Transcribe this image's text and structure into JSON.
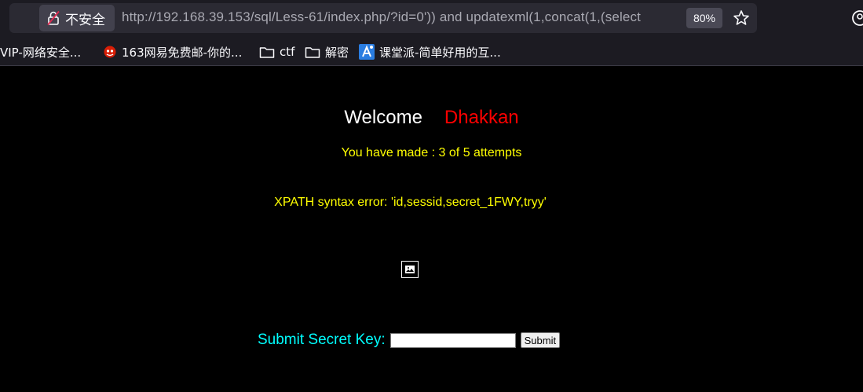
{
  "browser": {
    "security_label": "不安全",
    "url_host": "http://192.168.39.153",
    "url_rest": "/sql/Less-61/index.php/?id=0')) and updatexml(1,concat(1,(select",
    "zoom": "80%",
    "bookmarks": [
      {
        "label": "VIP-网络安全...",
        "icon": "none"
      },
      {
        "label": "163网易免费邮-你的...",
        "icon": "netease-icon"
      },
      {
        "label": "ctf",
        "icon": "folder-icon"
      },
      {
        "label": "解密",
        "icon": "folder-icon"
      },
      {
        "label": "课堂派-简单好用的互...",
        "icon": "ketangpai-icon"
      }
    ]
  },
  "page": {
    "welcome": "Welcome",
    "name": "Dhakkan",
    "attempts": "You have made : 3 of 5 attempts",
    "error": "XPATH syntax error: 'id,sessid,secret_1FWY,tryy'",
    "form": {
      "label": "Submit Secret Key:",
      "input_value": "",
      "submit_label": "Submit"
    }
  },
  "colors": {
    "background": "#000000",
    "welcome": "#ffffff",
    "name": "#ff0000",
    "attempts": "#ffff00",
    "form_label": "#00ffff"
  }
}
